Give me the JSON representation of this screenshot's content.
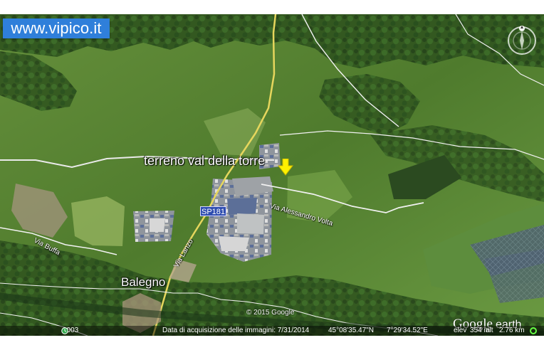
{
  "branding": {
    "watermark": "www.vipico.it",
    "viewer_brand_main": "Google",
    "viewer_brand_sub": "earth",
    "copyright": "© 2015 Google"
  },
  "map": {
    "title": "terreno val della torre",
    "town": "Balegno",
    "roads": {
      "via_buffa": "Via Buffa",
      "via_alessandro_volta": "Via Alessandro Volta",
      "via_lanzo": "Via Lanzo",
      "sp181": "SP181"
    },
    "colors": {
      "field_green": "#5c8a35",
      "forest_green": "#2f4f1f",
      "road_white": "#f2f2f2",
      "road_yellow": "#e8d85a",
      "industrial_gray": "#7e8693",
      "building_blue": "#5d6f98",
      "marker_yellow": "#fff200",
      "watermark_blue": "#2f7fda"
    },
    "icons": {
      "location_arrow": "yellow-down-arrow-icon",
      "compass": "compass-icon",
      "status_dot": "green-ring-icon",
      "history": "clock-icon"
    }
  },
  "status_bar": {
    "year": "2003",
    "acquisition": "Data di acquisizione delle immagini: 7/31/2014",
    "latitude": "45°08'35.47\"N",
    "longitude": "7°29'34.52\"E",
    "elevation_label": "elev",
    "elevation_value": "354 m",
    "altitude_label": "alt",
    "altitude_value": "2.76 km"
  }
}
